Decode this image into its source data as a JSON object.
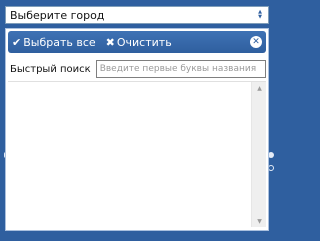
{
  "select": {
    "value": "Выберите город",
    "arrow_icon": "up-down-arrows-icon"
  },
  "panel": {
    "select_all_label": "Выбрать все",
    "clear_label": "Очистить",
    "close_icon": "close-icon"
  },
  "search": {
    "label": "Быстрый поиск",
    "placeholder": "Введите первые буквы названия",
    "value": ""
  },
  "colors": {
    "background": "#2f5f9f",
    "header": "#3f72b5"
  }
}
